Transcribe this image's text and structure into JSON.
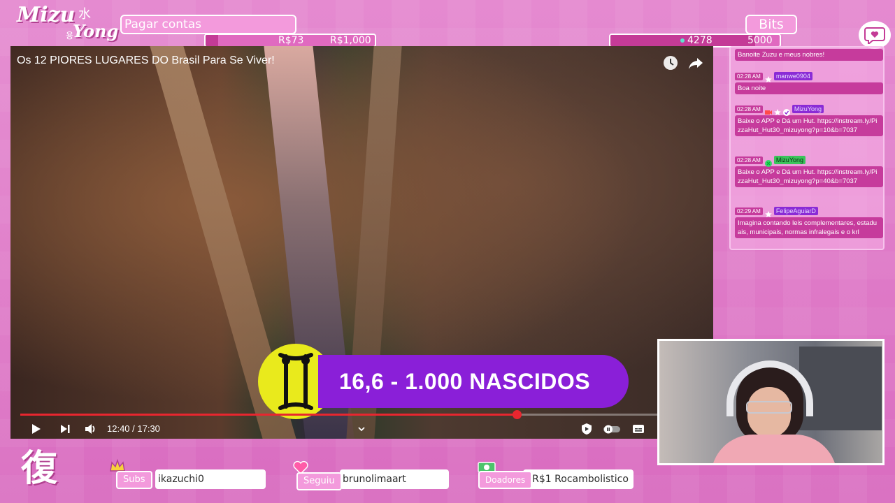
{
  "logo": {
    "line1": "Mizu",
    "kanji": "水",
    "line2": "Yong",
    "hangul": "용"
  },
  "goals": {
    "bills": {
      "label": "Pagar contas",
      "current": "R$73",
      "target": "R$1,000",
      "fraction": 0.073
    },
    "bits": {
      "label": "Bits",
      "current": "4278",
      "target": "5000",
      "fraction": 0.8556
    }
  },
  "video": {
    "title": "Os 12 PIORES LUGARES DO Brasil Para Se Viver!",
    "banner": "16,6 - 1.000 NASCIDOS",
    "time": "12:40 / 17:30",
    "progress": 0.724
  },
  "chat": {
    "messages": [
      {
        "time": "",
        "user": "",
        "badges": [],
        "text": "Banoite Zuzu e meus nobres!"
      },
      {
        "time": "02:28 AM",
        "user": "manwe0904",
        "badges": [
          "star-icon"
        ],
        "text": "Boa noite"
      },
      {
        "time": "02:28 AM",
        "user": "MizuYong",
        "badges": [
          "camera-icon",
          "star-icon",
          "verified-icon"
        ],
        "text": "Baixe o APP e Dá um Hut. https://instream.ly/PizzaHut_Hut30_mizuyong?p=10&b=7037"
      },
      {
        "time": "02:28 AM",
        "user": "MizuYong",
        "badges": [
          "bot-icon"
        ],
        "text": "Baixe o APP e Dá um Hut. https://instream.ly/PizzaHut_Hut30_mizuyong?p=40&b=7037"
      },
      {
        "time": "02:29 AM",
        "user": "FelipeAguiarD",
        "badges": [
          "star-icon"
        ],
        "text": "Imagina contando leis complementares, estaduais, municipais, normas infralegais e o krl"
      }
    ]
  },
  "bottom": {
    "kanji": "復",
    "subs": {
      "label": "Subs",
      "value": "ikazuchi0"
    },
    "follow": {
      "label": "Seguiu",
      "value": "brunolimaart"
    },
    "donors": {
      "label": "Doadores",
      "value": ": R$1   Rocambolistico"
    }
  },
  "colors": {
    "background": "#e27cc6",
    "accent": "#c43b97",
    "banner": "#8a1fd8",
    "zodiac": "#e9ea1c",
    "progress": "#e8262f"
  }
}
